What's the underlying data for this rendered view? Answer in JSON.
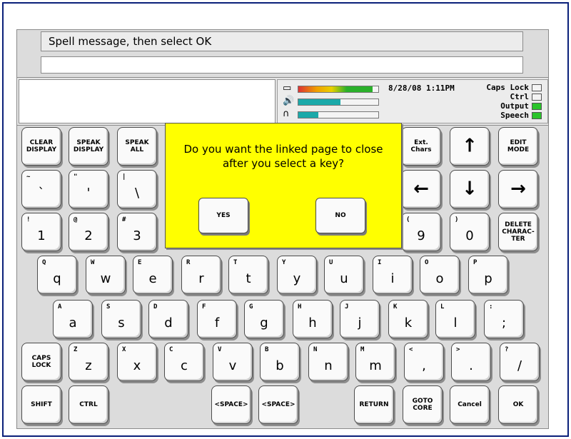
{
  "prompt": "Spell message, then select OK",
  "status": {
    "datetime": "8/28/08 1:11PM",
    "caps_lock": "Caps Lock",
    "ctrl": "Ctrl",
    "output": "Output",
    "speech": "Speech",
    "battery_level": 0.93,
    "volume_level": 0.53,
    "headset_level": 0.25,
    "battery_icon": "battery-icon",
    "speaker_icon": "speaker-icon",
    "headphones_icon": "headphones-icon",
    "indicator_on_color": "#2ac42a"
  },
  "dialog": {
    "line1": "Do you want the linked page to close",
    "line2": "after you select a key?",
    "yes": "YES",
    "no": "NO",
    "background": "#ffff00"
  },
  "keys": {
    "clear_display_1": "CLEAR",
    "clear_display_2": "DISPLAY",
    "speak_display_1": "SPEAK",
    "speak_display_2": "DISPLAY",
    "speak_all_1": "SPEAK",
    "speak_all_2": "ALL",
    "ext_chars_1": "Ext.",
    "ext_chars_2": "Chars",
    "edit_mode_1": "EDIT",
    "edit_mode_2": "MODE",
    "delete_1": "DELETE",
    "delete_2": "CHARAC-",
    "delete_3": "TER",
    "caps_lock_1": "CAPS",
    "caps_lock_2": "LOCK",
    "shift": "SHIFT",
    "ctrl": "CTRL",
    "space1": "<SPACE>",
    "space2": "<SPACE>",
    "return": "RETURN",
    "goto_core_1": "GOTO",
    "goto_core_2": "CORE",
    "cancel": "Cancel",
    "ok": "OK",
    "up": "↑",
    "down": "↓",
    "left": "←",
    "right": "→",
    "backtick": "`",
    "backtick_shift": "~",
    "quote": "'",
    "quote_shift": "\"",
    "backslash": "\\",
    "backslash_shift": "|",
    "n1": "1",
    "n1s": "!",
    "n2": "2",
    "n2s": "@",
    "n3": "3",
    "n3s": "#",
    "n9": "9",
    "n9s": "(",
    "n0": "0",
    "n0s": ")",
    "q": "q",
    "qs": "Q",
    "w": "w",
    "ws": "W",
    "e": "e",
    "es": "E",
    "r": "r",
    "rs": "R",
    "t": "t",
    "ts": "T",
    "y": "y",
    "ys": "Y",
    "u": "u",
    "us": "U",
    "i": "i",
    "is": "I",
    "o": "o",
    "os": "O",
    "p": "p",
    "ps": "P",
    "a": "a",
    "as": "A",
    "s": "s",
    "ss": "S",
    "d": "d",
    "ds": "D",
    "f": "f",
    "fs": "F",
    "g": "g",
    "gs": "G",
    "h": "h",
    "hs": "H",
    "j": "j",
    "js": "J",
    "k": "k",
    "ks": "K",
    "l": "l",
    "ls": "L",
    "semi": ";",
    "semis": ":",
    "z": "z",
    "zs": "Z",
    "x": "x",
    "xs": "X",
    "c": "c",
    "cs": "C",
    "v": "v",
    "vs": "V",
    "b": "b",
    "bs": "B",
    "n": "n",
    "ns": "N",
    "m": "m",
    "ms": "M",
    "comma": ",",
    "commas": "<",
    "period": ".",
    "periods": ">",
    "slash": "/",
    "slashs": "?"
  }
}
